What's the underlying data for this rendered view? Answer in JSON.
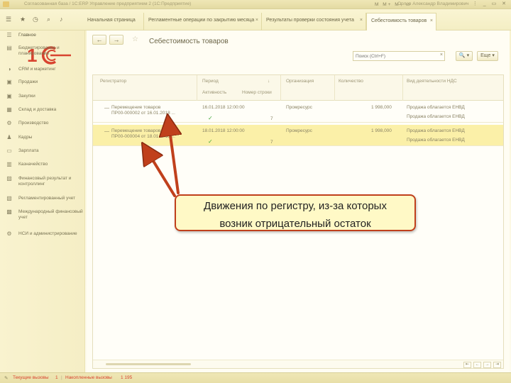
{
  "window": {
    "title": "Согласованная база / 1С:ERP Управление предприятием 2 (1С:Предприятие)",
    "toolbar_icons": "M  M+  M-  ▭",
    "user": "Орлов Александр Владимирович",
    "controls": "⋮ _ ▭ ✕"
  },
  "tabs": [
    {
      "label": "Начальная страница",
      "close": ""
    },
    {
      "label": "Регламентные операции по закрытию месяца",
      "close": "×"
    },
    {
      "label": "Результаты проверки состояния учета",
      "close": "×"
    },
    {
      "label": "Себестоимость товаров",
      "close": "×"
    }
  ],
  "sidebar": {
    "items": [
      {
        "icon": "☰",
        "label": "Главное"
      },
      {
        "icon": "▤",
        "label": "Бюджетирование и планирование"
      },
      {
        "icon": "◑",
        "label": "CRM и маркетинг"
      },
      {
        "icon": "▣",
        "label": "Продажи"
      },
      {
        "icon": "▣",
        "label": "Закупки"
      },
      {
        "icon": "▦",
        "label": "Склад и доставка"
      },
      {
        "icon": "⚙",
        "label": "Производство"
      },
      {
        "icon": "♟",
        "label": "Кадры"
      },
      {
        "icon": "▭",
        "label": "Зарплата"
      },
      {
        "icon": "▥",
        "label": "Казначейство"
      },
      {
        "icon": "▨",
        "label": "Финансовый результат и контроллинг"
      },
      {
        "icon": "▧",
        "label": "Регламентированный учет"
      },
      {
        "icon": "▩",
        "label": "Международный финансовый учет"
      },
      {
        "icon": "⚙",
        "label": "НСИ и администрирование"
      }
    ]
  },
  "page": {
    "title": "Себестоимость товаров",
    "back": "←",
    "forward": "→",
    "star": "☆"
  },
  "search": {
    "placeholder": "Поиск (Ctrl+F)",
    "clear": "×"
  },
  "buttons": {
    "find": "🔍 ▾",
    "more": "Еще ▾"
  },
  "table": {
    "headers": {
      "registrar": "Регистратор",
      "period": "Период",
      "sort_mark": "↓",
      "activity": "Активность",
      "line_number": "Номер строки",
      "organization": "Организация",
      "quantity": "Количество",
      "vat_activity": "Вид деятельности НДС"
    },
    "rows": [
      {
        "dash": "—",
        "registrar_line1": "Перемещение товаров",
        "registrar_line2": "ПР00-000002 от 16.01.2018 ...",
        "period": "16.01.2018 12:00:00",
        "active": "✓",
        "line_no": "7",
        "organization": "Промресурс",
        "quantity": "1 998,000",
        "vat1": "Продажа облагается ЕНВД",
        "vat2": "Продажа облагается ЕНВД"
      },
      {
        "dash": "—",
        "registrar_line1": "Перемещение товаров",
        "registrar_line2": "ПР00-000004 от 18.01.2018 ...",
        "period": "18.01.2018 12:00:00",
        "active": "✓",
        "line_no": "7",
        "organization": "Промресурс",
        "quantity": "1 998,000",
        "vat1": "Продажа облагается ЕНВД",
        "vat2": "Продажа облагается ЕНВД"
      }
    ],
    "pager": [
      "⇤",
      "←",
      "→",
      "⇥"
    ]
  },
  "status": {
    "current_calls_label": "Текущие вызовы",
    "current_calls_value": "1",
    "accumulated_label": "Накопленные вызовы",
    "accumulated_value": "1 195"
  },
  "annotation": {
    "line1": "Движения по регистру, из-за которых",
    "line2": "возник отрицательный остаток",
    "color": "#c0401c"
  }
}
